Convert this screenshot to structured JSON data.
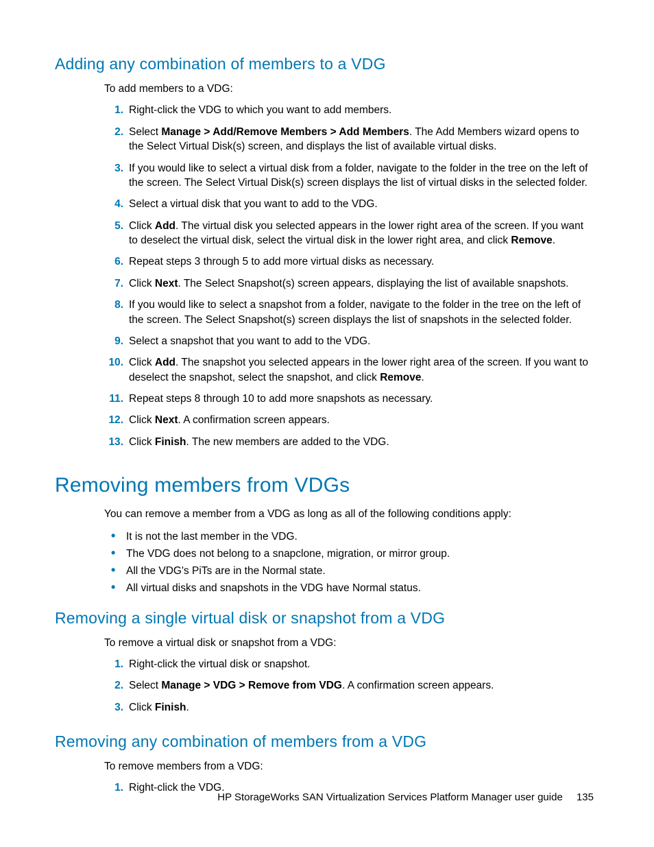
{
  "section1": {
    "heading": "Adding any combination of members to a VDG",
    "intro": "To add members to a VDG:",
    "steps": {
      "s1": "Right-click the VDG to which you want to add members.",
      "s2a": "Select ",
      "s2b": "Manage > Add/Remove Members > Add Members",
      "s2c": ". The Add Members wizard opens to the Select Virtual Disk(s) screen, and displays the list of available virtual disks.",
      "s3": "If you would like to select a virtual disk from a folder, navigate to the folder in the tree on the left of the screen. The Select Virtual Disk(s) screen displays the list of virtual disks in the selected folder.",
      "s4": "Select a virtual disk that you want to add to the VDG.",
      "s5a": "Click ",
      "s5b": "Add",
      "s5c": ". The virtual disk you selected appears in the lower right area of the screen. If you want to deselect the virtual disk, select the virtual disk in the lower right area, and click ",
      "s5d": "Remove",
      "s5e": ".",
      "s6": "Repeat steps 3 through 5 to add more virtual disks as necessary.",
      "s7a": "Click ",
      "s7b": "Next",
      "s7c": ". The Select Snapshot(s) screen appears, displaying the list of available snapshots.",
      "s8": "If you would like to select a snapshot from a folder, navigate to the folder in the tree on the left of the screen. The Select Snapshot(s) screen displays the list of snapshots in the selected folder.",
      "s9": "Select a snapshot that you want to add to the VDG.",
      "s10a": "Click ",
      "s10b": "Add",
      "s10c": ". The snapshot you selected appears in the lower right area of the screen. If you want to deselect the snapshot, select the snapshot, and click ",
      "s10d": "Remove",
      "s10e": ".",
      "s11": "Repeat steps 8 through 10 to add more snapshots as necessary.",
      "s12a": "Click ",
      "s12b": "Next",
      "s12c": ". A confirmation screen appears.",
      "s13a": "Click ",
      "s13b": "Finish",
      "s13c": ". The new members are added to the VDG."
    }
  },
  "section2": {
    "heading": "Removing members from VDGs",
    "intro": "You can remove a member from a VDG as long as all of the following conditions apply:",
    "bullets": {
      "b1": "It is not the last member in the VDG.",
      "b2": "The VDG does not belong to a snapclone, migration, or mirror group.",
      "b3": "All the VDG's PiTs are in the Normal state.",
      "b4": "All virtual disks and snapshots in the VDG have Normal status."
    }
  },
  "section3": {
    "heading": "Removing a single virtual disk or snapshot from a VDG",
    "intro": "To remove a virtual disk or snapshot from a VDG:",
    "steps": {
      "s1": "Right-click the virtual disk or snapshot.",
      "s2a": "Select ",
      "s2b": "Manage > VDG > Remove from VDG",
      "s2c": ". A confirmation screen appears.",
      "s3a": "Click ",
      "s3b": "Finish",
      "s3c": "."
    }
  },
  "section4": {
    "heading": "Removing any combination of members from a VDG",
    "intro": "To remove members from a VDG:",
    "steps": {
      "s1": "Right-click the VDG."
    }
  },
  "footer": {
    "title": "HP StorageWorks SAN Virtualization Services Platform Manager user guide",
    "page": "135"
  }
}
